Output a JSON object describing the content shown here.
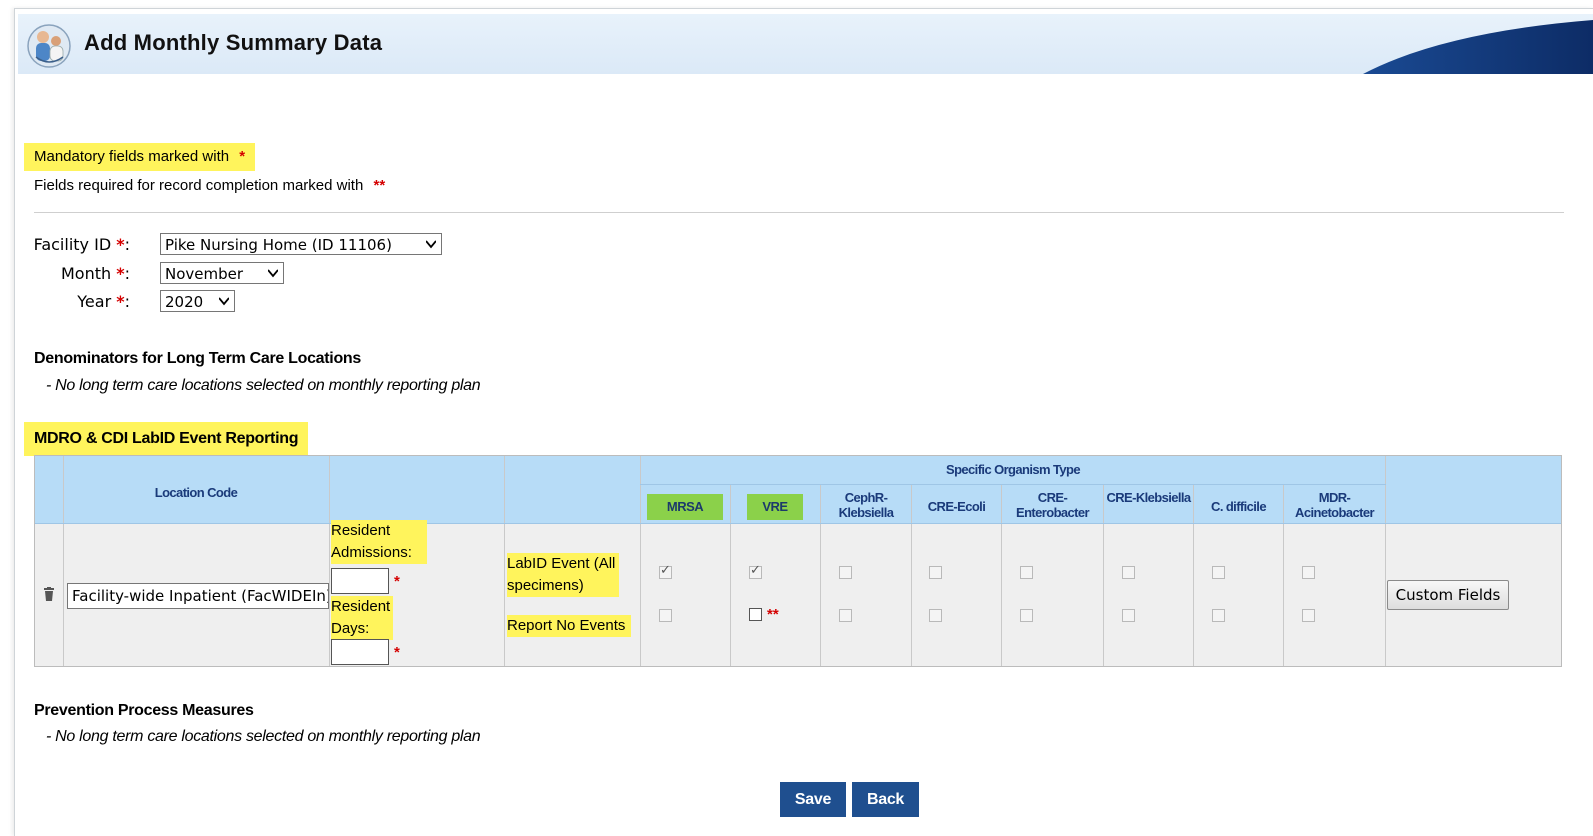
{
  "header": {
    "title": "Add Monthly Summary Data"
  },
  "notes": {
    "mandatory": "Mandatory fields marked with",
    "mandatory_mark": "*",
    "completion": "Fields required for record completion marked with",
    "completion_mark": "**"
  },
  "form": {
    "facility_label": "Facility ID",
    "facility_value": "Pike Nursing Home (ID 11106)",
    "month_label": "Month",
    "month_value": "November",
    "year_label": "Year",
    "year_value": "2020",
    "req_mark": "*",
    "colon": ":"
  },
  "denominators": {
    "title": "Denominators for Long Term Care Locations",
    "note": "- No long term care locations selected on monthly reporting plan"
  },
  "mdro": {
    "title": "MDRO & CDI LabID Event Reporting",
    "col_location": "Location Code",
    "col_specific": "Specific Organism Type",
    "organisms": [
      {
        "label": "MRSA",
        "highlight": true
      },
      {
        "label": "VRE",
        "highlight": true
      },
      {
        "label": "CephR-Klebsiella",
        "highlight": false
      },
      {
        "label": "CRE-Ecoli",
        "highlight": false
      },
      {
        "label": "CRE-Enterobacter",
        "highlight": false
      },
      {
        "label": "CRE-Klebsiella",
        "highlight": false
      },
      {
        "label": "C. difficile",
        "highlight": false
      },
      {
        "label": "MDR-Acinetobacter",
        "highlight": false
      }
    ],
    "location_value": "Facility-wide Inpatient (FacWIDEIn)",
    "resident_admissions_label": "Resident Admissions:",
    "resident_days_label": "Resident Days:",
    "labid_event_label": "LabID Event (All specimens)",
    "report_no_events_label": "Report No Events",
    "labid_checked": [
      true,
      true,
      false,
      false,
      false,
      false,
      false,
      false
    ],
    "no_events_checked": [
      false,
      false,
      false,
      false,
      false,
      false,
      false,
      false
    ],
    "req_mark": "*",
    "completion_mark": "**",
    "custom_fields_button": "Custom Fields"
  },
  "prevention": {
    "title": "Prevention Process Measures",
    "note": "- No long term care locations selected on monthly reporting plan"
  },
  "buttons": {
    "save": "Save",
    "back": "Back"
  },
  "colors": {
    "highlight": "#fff45c",
    "header_blue": "#b7dcf7",
    "button_blue": "#1f4f8f",
    "organism_green": "#8bd14a",
    "required_red": "#d40000"
  }
}
